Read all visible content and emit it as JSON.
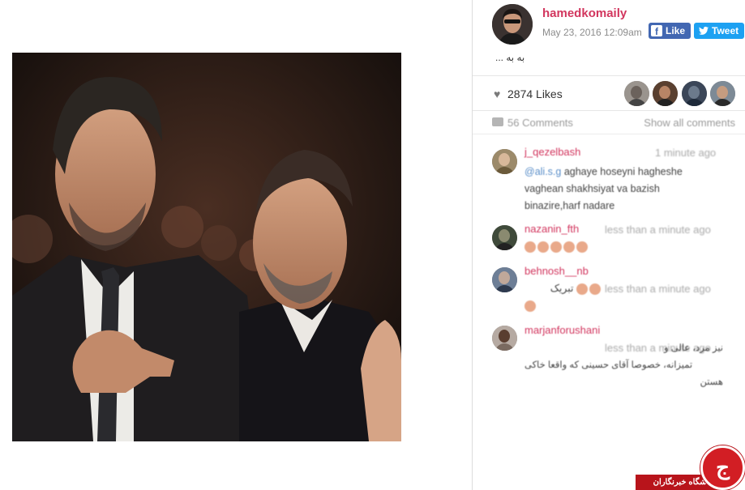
{
  "post": {
    "username": "hamedkomaily",
    "date": "May 23, 2016 12:09am",
    "caption": "به به ...",
    "likes_label": "2874 Likes",
    "comments_label": "56 Comments",
    "show_all_label": "Show all comments"
  },
  "share": {
    "like_label": "Like",
    "tweet_label": "Tweet"
  },
  "comments": [
    {
      "user": "j_qezelbash",
      "time": "1 minute ago",
      "mention": "@ali.s.g",
      "lines": [
        "aghaye hoseyni hagheshe",
        "vaghean shakhsiyat va bazish",
        "binazire,harf nadare"
      ]
    },
    {
      "user": "nazanin_fth",
      "time": "less than a minute ago",
      "emoji_count": 5
    },
    {
      "user": "behnosh__nb",
      "time": "less than a minute ago",
      "text": "تبریک"
    },
    {
      "user": "marjanforushani",
      "time": "less than a minute ago",
      "lines": [
        "نیز مرد، عالی و",
        "تمیزانه، خصوصا آقای حسینی که واقعا خاکی",
        "هستن"
      ]
    }
  ],
  "logo": {
    "label": "باشگاه خبرنگاران",
    "mark": "ج"
  },
  "colors": {
    "username": "#d2365e",
    "facebook": "#4267b2",
    "twitter": "#1da1f2",
    "logo_red": "#d21e24"
  }
}
